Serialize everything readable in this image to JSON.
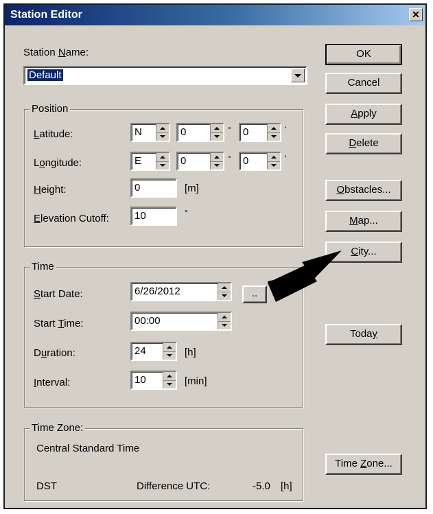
{
  "window": {
    "title": "Station Editor",
    "close_glyph": "✕"
  },
  "station_name": {
    "label": "Station Name:",
    "value": "Default"
  },
  "position": {
    "group_title": "Position",
    "latitude": {
      "label": "Latitude:",
      "hemisphere": "N",
      "degrees": "0",
      "minutes": "0",
      "deg_unit": "°",
      "min_unit": "'"
    },
    "longitude": {
      "label": "Longitude:",
      "hemisphere": "E",
      "degrees": "0",
      "minutes": "0",
      "deg_unit": "°",
      "min_unit": "'"
    },
    "height": {
      "label": "Height:",
      "value": "0",
      "unit": "[m]"
    },
    "elevation_cutoff": {
      "label": "Elevation Cutoff:",
      "value": "10",
      "unit": "°"
    }
  },
  "time": {
    "group_title": "Time",
    "start_date": {
      "label": "Start Date:",
      "value": "6/26/2012",
      "browse_label": ".."
    },
    "start_time": {
      "label": "Start Time:",
      "value": "00:00"
    },
    "duration": {
      "label": "Duration:",
      "value": "24",
      "unit": "[h]"
    },
    "interval": {
      "label": "Interval:",
      "value": "10",
      "unit": "[min]"
    }
  },
  "time_zone": {
    "group_title": "Time Zone:",
    "name": "Central Standard Time",
    "dst": "DST",
    "difference_label": "Difference UTC:",
    "difference_value": "-5.0",
    "difference_unit": "[h]"
  },
  "buttons": {
    "ok": "OK",
    "cancel": "Cancel",
    "apply": "Apply",
    "delete": "Delete",
    "obstacles": "Obstacles...",
    "map": "Map...",
    "city": "City...",
    "today": "Today",
    "time_zone": "Time Zone..."
  },
  "annotation": {
    "arrow_icon": "black-arrow-icon"
  }
}
